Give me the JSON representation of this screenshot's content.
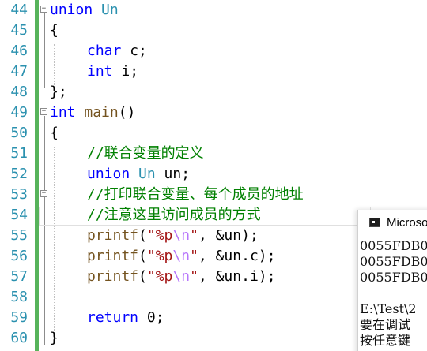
{
  "editor": {
    "lines": [
      {
        "num": "44"
      },
      {
        "num": "45"
      },
      {
        "num": "46"
      },
      {
        "num": "47"
      },
      {
        "num": "48"
      },
      {
        "num": "49"
      },
      {
        "num": "50"
      },
      {
        "num": "51"
      },
      {
        "num": "52"
      },
      {
        "num": "53"
      },
      {
        "num": "54"
      },
      {
        "num": "55"
      },
      {
        "num": "56"
      },
      {
        "num": "57"
      },
      {
        "num": "58"
      },
      {
        "num": "59"
      },
      {
        "num": "60"
      }
    ],
    "code": {
      "l44_kw": "union",
      "l44_ty": "Un",
      "l45": "{",
      "l46_kw": "char",
      "l46_rest": " c;",
      "l47_kw": "int",
      "l47_rest": " i;",
      "l48": "};",
      "l49_kw": "int",
      "l49_fn": "main",
      "l49_rest": "()",
      "l50": "{",
      "l51_cm": "//联合变量的定义",
      "l52_kw": "union",
      "l52_ty": "Un",
      "l52_rest": " un;",
      "l53_cm": "//打印联合变量、每个成员的地址",
      "l54_cm": "//注意这里访问成员的方式",
      "l55_fn": "printf",
      "l55_open": "(",
      "l55_str1": "\"%p",
      "l55_esc": "\\n",
      "l55_str2": "\"",
      "l55_rest": ", &un);",
      "l56_fn": "printf",
      "l56_open": "(",
      "l56_str1": "\"%p",
      "l56_esc": "\\n",
      "l56_str2": "\"",
      "l56_rest": ", &un.c);",
      "l57_fn": "printf",
      "l57_open": "(",
      "l57_str1": "\"%p",
      "l57_esc": "\\n",
      "l57_str2": "\"",
      "l57_rest": ", &un.i);",
      "l58": "",
      "l59_kw": "return",
      "l59_rest": " 0;",
      "l60": "}"
    },
    "fold_collapse_glyph": "⊟"
  },
  "console": {
    "title": "Microso",
    "lines": [
      "0055FDB0",
      "0055FDB0",
      "0055FDB0",
      "",
      "E:\\Test\\2",
      "要在调试",
      "按任意键"
    ]
  },
  "colors": {
    "keyword": "#0000ff",
    "type": "#2b91af",
    "function": "#74531f",
    "string": "#a31515",
    "escape": "#b776fb",
    "comment": "#008000",
    "line_number": "#2b91af",
    "change_bar": "#57b35b"
  }
}
